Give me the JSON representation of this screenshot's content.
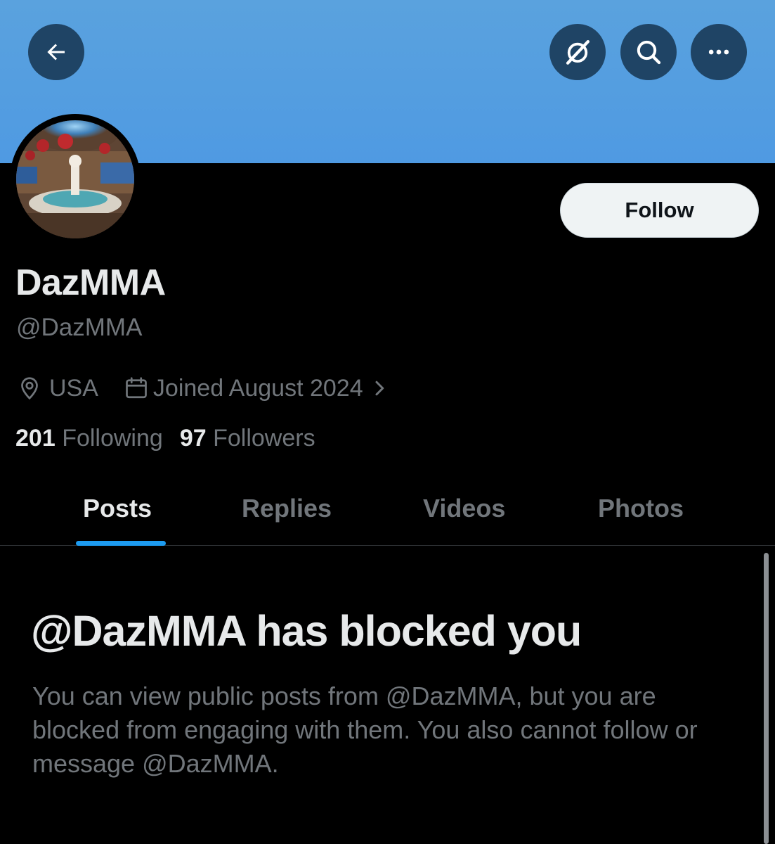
{
  "header": {
    "back_icon": "arrow-left-icon",
    "grok_icon": "grok-icon",
    "search_icon": "search-icon",
    "more_icon": "more-icon"
  },
  "profile": {
    "display_name": "DazMMA",
    "handle": "@DazMMA",
    "follow_label": "Follow",
    "location": "USA",
    "joined": "Joined August 2024",
    "following_count": "201",
    "following_label": "Following",
    "followers_count": "97",
    "followers_label": "Followers"
  },
  "tabs": [
    {
      "label": "Posts",
      "active": true
    },
    {
      "label": "Replies",
      "active": false
    },
    {
      "label": "Videos",
      "active": false
    },
    {
      "label": "Photos",
      "active": false
    }
  ],
  "blocked": {
    "title": "@DazMMA has blocked you",
    "body": "You can view public posts from @DazMMA, but you are blocked from engaging with them. You also cannot follow or message @DazMMA."
  },
  "colors": {
    "banner": "#4f9ae2",
    "accent": "#1d9bf0",
    "background": "#000000",
    "muted_text": "#71767b"
  }
}
